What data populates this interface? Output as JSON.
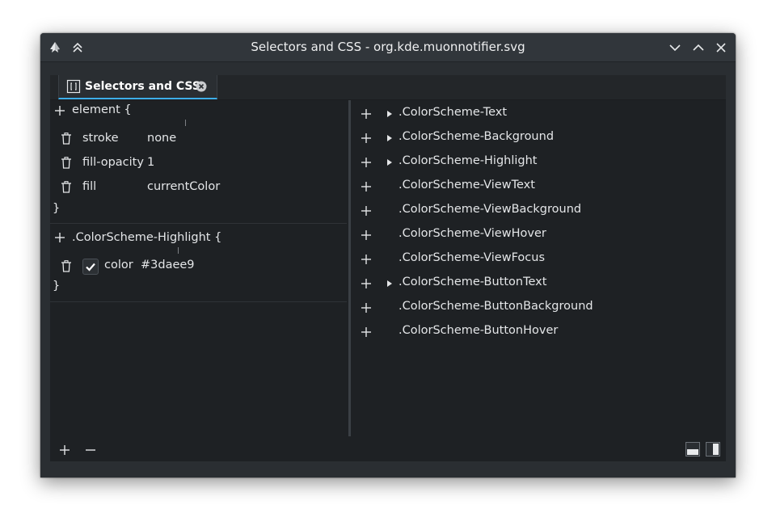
{
  "window": {
    "title": "Selectors and CSS - org.kde.muonnotifier.svg"
  },
  "tab": {
    "label": "Selectors and CSS"
  },
  "rules": [
    {
      "selector": "element {",
      "closing": "}",
      "properties": [
        {
          "name": "stroke",
          "value": "none"
        },
        {
          "name": "fill-opacity",
          "value": "1"
        },
        {
          "name": "fill",
          "value": "currentColor"
        }
      ]
    },
    {
      "selector": ".ColorScheme-Highlight {",
      "closing": "}",
      "properties": [
        {
          "name": "color",
          "value": "#3daee9",
          "enabled": true
        }
      ]
    }
  ],
  "selectors": [
    {
      "label": ".ColorScheme-Text",
      "expandable": true
    },
    {
      "label": ".ColorScheme-Background",
      "expandable": true
    },
    {
      "label": ".ColorScheme-Highlight",
      "expandable": true
    },
    {
      "label": ".ColorScheme-ViewText",
      "expandable": false
    },
    {
      "label": ".ColorScheme-ViewBackground",
      "expandable": false
    },
    {
      "label": ".ColorScheme-ViewHover",
      "expandable": false
    },
    {
      "label": ".ColorScheme-ViewFocus",
      "expandable": false
    },
    {
      "label": ".ColorScheme-ButtonText",
      "expandable": true
    },
    {
      "label": ".ColorScheme-ButtonBackground",
      "expandable": false
    },
    {
      "label": ".ColorScheme-ButtonHover",
      "expandable": false
    }
  ],
  "icons": {
    "app": "inkscape-icon",
    "keep_above": "keep-above-icon",
    "minimize": "chevron-down-icon",
    "maximize": "chevron-up-icon",
    "close": "close-icon",
    "add": "plus-icon",
    "remove": "minus-icon",
    "delete": "trash-icon",
    "expand": "triangle-right-icon"
  },
  "colors": {
    "accent": "#3daee9",
    "window_bg": "#2a2e32",
    "panel_bg": "#1e2124",
    "text": "#e4e6e8"
  }
}
